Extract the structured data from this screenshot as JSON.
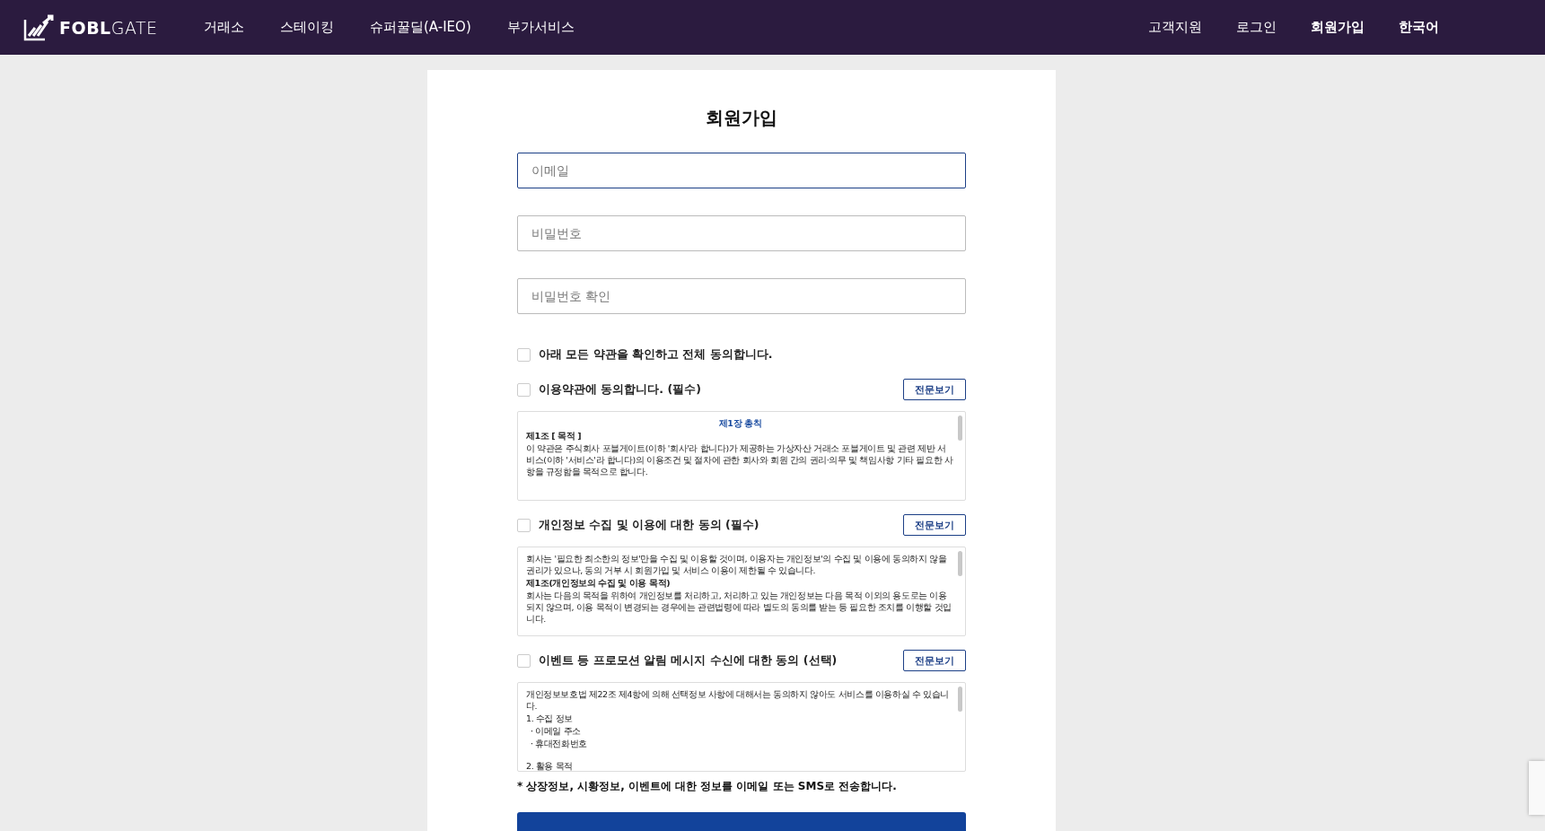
{
  "header": {
    "logo": "FOBL",
    "logo_light": "GATE",
    "nav": [
      {
        "label": "거래소",
        "selected": false
      },
      {
        "label": "스테이킹",
        "selected": false
      },
      {
        "label": "슈퍼꿀딜(A-IEO)",
        "selected": false
      },
      {
        "label": "부가서비스",
        "selected": false
      }
    ],
    "right_nav": [
      {
        "label": "고객지원",
        "selected": false
      },
      {
        "label": "로그인",
        "selected": false
      },
      {
        "label": "회원가입",
        "selected": true
      },
      {
        "label": "한국어",
        "selected": true
      }
    ]
  },
  "form": {
    "title": "회원가입",
    "fields": [
      {
        "placeholder": "이메일",
        "focused": true
      },
      {
        "placeholder": "비밀번호",
        "focused": false
      },
      {
        "placeholder": "비밀번호 확인",
        "focused": false
      }
    ],
    "agree_all": {
      "label": "아래 모든 약관을 확인하고 전체 동의합니다.",
      "checked": false
    },
    "agreements": [
      {
        "label": "이용약관에 동의합니다. (필수)",
        "checked": false,
        "button": "전문보기",
        "lines": [
          {
            "kind": "heading",
            "text": "제1장 총칙"
          },
          {
            "kind": "bold",
            "text": "제1조 [ 목적 ]"
          },
          {
            "kind": "text",
            "text": "이 약관은 주식회사 포블게이트(이하 '회사'라 합니다)가 제공하는 가상자산 거래소 포블게이트 및 관련 제반 서비스(이하 '서비스'라 합니다)의 이용조건 및 절차에 관한 회사와 회원 간의 권리·의무 및 책임사항 기타 필요한 사항을 규정함을 목적으로 합니다."
          }
        ]
      },
      {
        "label": "개인정보 수집 및 이용에 대한 동의 (필수)",
        "checked": false,
        "button": "전문보기",
        "lines": [
          {
            "kind": "text",
            "text": "회사는 '필요한 최소한의 정보'만을 수집 및 이용할 것이며, 이용자는 개인정보'의 수집 및 이용에 동의하지 않을 권리가 있으나, 동의 거부 시 회원가입 및 서비스 이용이 제한될 수 있습니다."
          },
          {
            "kind": "bold",
            "text": "제1조(개인정보의 수집 및 이용 목적)"
          },
          {
            "kind": "text",
            "text": "회사는 다음의 목적을 위하여 개인정보를 처리하고, 처리하고 있는 개인정보는 다음 목적 이외의 용도로는 이용되지 않으며, 이용 목적이 변경되는 경우에는 관련법령에 따라 별도의 동의를 받는 등 필요한 조치를 이행할 것입니다."
          }
        ]
      },
      {
        "label": "이벤트 등 프로모션 알림 메시지 수신에 대한 동의 (선택)",
        "checked": false,
        "button": "전문보기",
        "lines": [
          {
            "kind": "text",
            "text": "개인정보보호법 제22조 제4항에 의해 선택정보 사항에 대해서는 동의하지 않아도 서비스를 이용하실 수 있습니다."
          },
          {
            "kind": "text",
            "text": "1. 수집 정보"
          },
          {
            "kind": "item",
            "text": "· 이메일 주소"
          },
          {
            "kind": "item",
            "text": "· 휴대전화번호"
          },
          {
            "kind": "gap"
          },
          {
            "kind": "text",
            "text": "2. 활용 목적"
          }
        ]
      }
    ],
    "note": "* 상장정보, 시황정보, 이벤트에 대한 정보를 이메일 또는 SMS로 전송합니다."
  }
}
